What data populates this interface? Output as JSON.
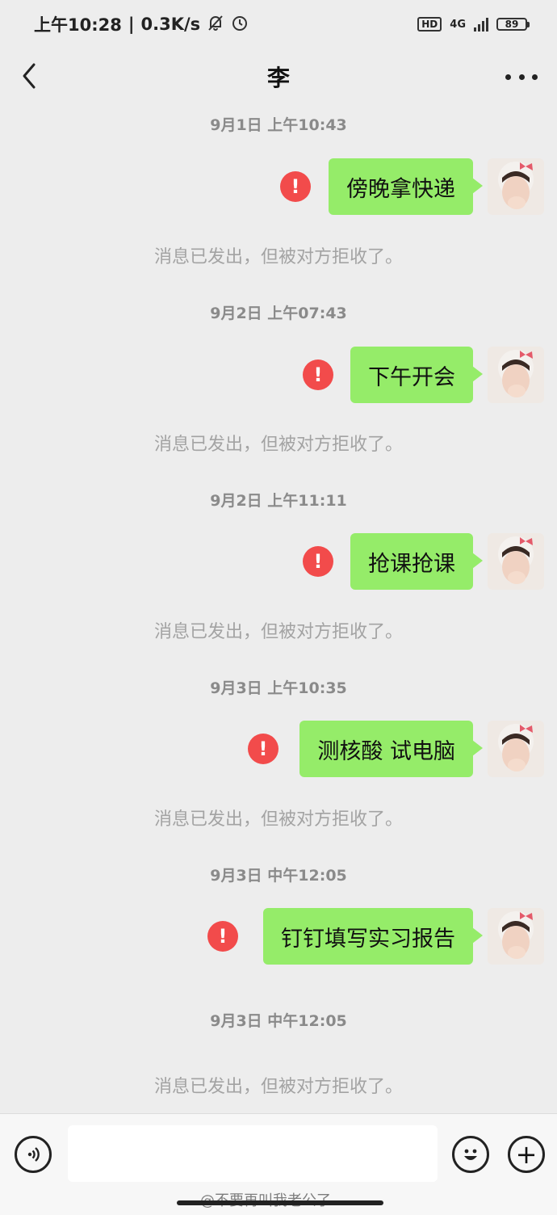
{
  "status_bar": {
    "time": "上午10:28",
    "speed": "0.3K/s",
    "network_badge": "HD",
    "network_type": "4G",
    "battery": "89"
  },
  "nav": {
    "title": "李"
  },
  "messages": [
    {
      "time": "9月1日 上午10:43",
      "text": "傍晚拿快递",
      "notice": "消息已发出，但被对方拒收了。"
    },
    {
      "time": "9月2日 上午07:43",
      "text": "下午开会",
      "notice": "消息已发出，但被对方拒收了。"
    },
    {
      "time": "9月2日 上午11:11",
      "text": "抢课抢课",
      "notice": "消息已发出，但被对方拒收了。"
    },
    {
      "time": "9月3日 上午10:35",
      "text": "测核酸 试电脑",
      "notice": "消息已发出，但被对方拒收了。"
    },
    {
      "time": "9月3日 中午12:05",
      "text": "钉钉填写实习报告",
      "notice": ""
    },
    {
      "time": "9月3日 中午12:05",
      "text": "",
      "notice": "消息已发出，但被对方拒收了。"
    }
  ],
  "error_mark": "!",
  "input_bar": {
    "placeholder": "",
    "plus_label": "+"
  },
  "watermark": "@不要再叫我老公了",
  "colors": {
    "bubble": "#95ec69",
    "error": "#f24b4b",
    "background": "#ededed"
  },
  "icons": [
    "back-icon",
    "more-icon",
    "voice-icon",
    "emoji-icon",
    "plus-icon",
    "alarm-icon",
    "bell-off-icon"
  ]
}
